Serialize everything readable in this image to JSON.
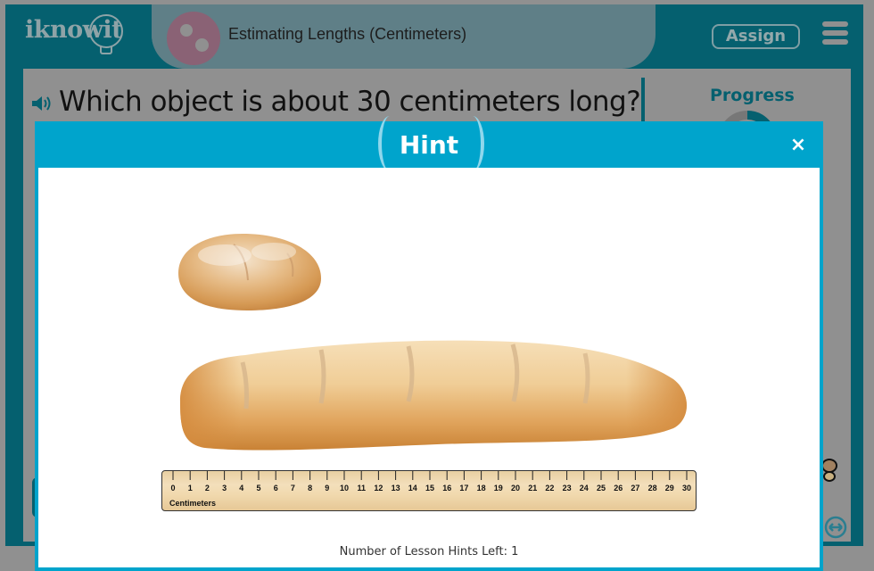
{
  "header": {
    "logo_text": "iknowit",
    "lesson_title": "Estimating Lengths (Centimeters)",
    "assign_label": "Assign",
    "menu_icon": "hamburger-menu-icon"
  },
  "question": {
    "text": "Which object is about 30 centimeters long?",
    "audio_icon": "speaker-icon"
  },
  "progress": {
    "label": "Progress"
  },
  "colors": {
    "brand_dark": "#05606f",
    "modal_accent": "#00a4cc",
    "overlay": "#909090"
  },
  "hint_modal": {
    "title": "Hint",
    "close_label": "×",
    "images": [
      {
        "name": "round-bread-loaf",
        "description": "small round loaf of bread"
      },
      {
        "name": "long-bread-loaf",
        "description": "long loaf of bread about 30 centimeters"
      }
    ],
    "ruler": {
      "unit_label": "Centimeters",
      "min": 0,
      "max": 30,
      "ticks": [
        "0",
        "1",
        "2",
        "3",
        "4",
        "5",
        "6",
        "7",
        "8",
        "9",
        "10",
        "11",
        "12",
        "13",
        "14",
        "15",
        "16",
        "17",
        "18",
        "19",
        "20",
        "21",
        "22",
        "23",
        "24",
        "25",
        "26",
        "27",
        "28",
        "29",
        "30"
      ]
    },
    "hints_left_text": "Number of Lesson Hints Left: 1"
  }
}
